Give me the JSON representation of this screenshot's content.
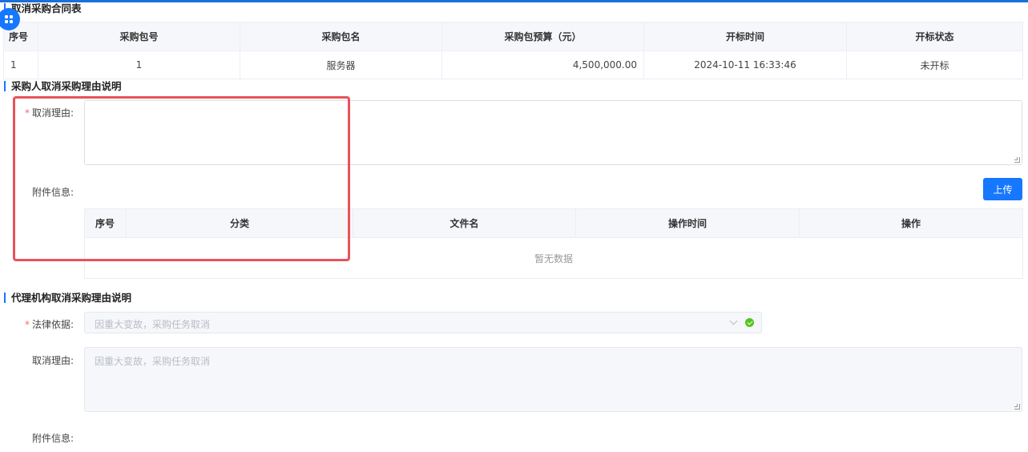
{
  "contract_table": {
    "title": "取消采购合同表",
    "headers": [
      "序号",
      "采购包号",
      "采购包名",
      "采购包预算（元）",
      "开标时间",
      "开标状态"
    ],
    "rows": [
      [
        "1",
        "1",
        "服务器",
        "4,500,000.00",
        "2024-10-11 16:33:46",
        "未开标"
      ]
    ]
  },
  "buyer_section": {
    "title": "采购人取消采购理由说明",
    "reason_label": "取消理由:",
    "attachment_label": "附件信息:",
    "upload_label": "上传",
    "attachment_table": {
      "headers": [
        "序号",
        "分类",
        "文件名",
        "操作时间",
        "操作"
      ],
      "empty_text": "暂无数据"
    }
  },
  "agency_section": {
    "title": "代理机构取消采购理由说明",
    "legal_label": "法律依据:",
    "legal_value": "因重大变故，采购任务取消",
    "reason_label": "取消理由:",
    "reason_placeholder": "因重大变故，采购任务取消",
    "attachment_label": "附件信息:"
  },
  "colors": {
    "accent": "#1677ff",
    "highlight": "#e8535b",
    "required": "#f56c6c",
    "success": "#52c41a"
  },
  "icons": {
    "fab": "grid-icon",
    "select_arrow": "chevron-down-icon",
    "select_status": "check-circle-icon"
  }
}
